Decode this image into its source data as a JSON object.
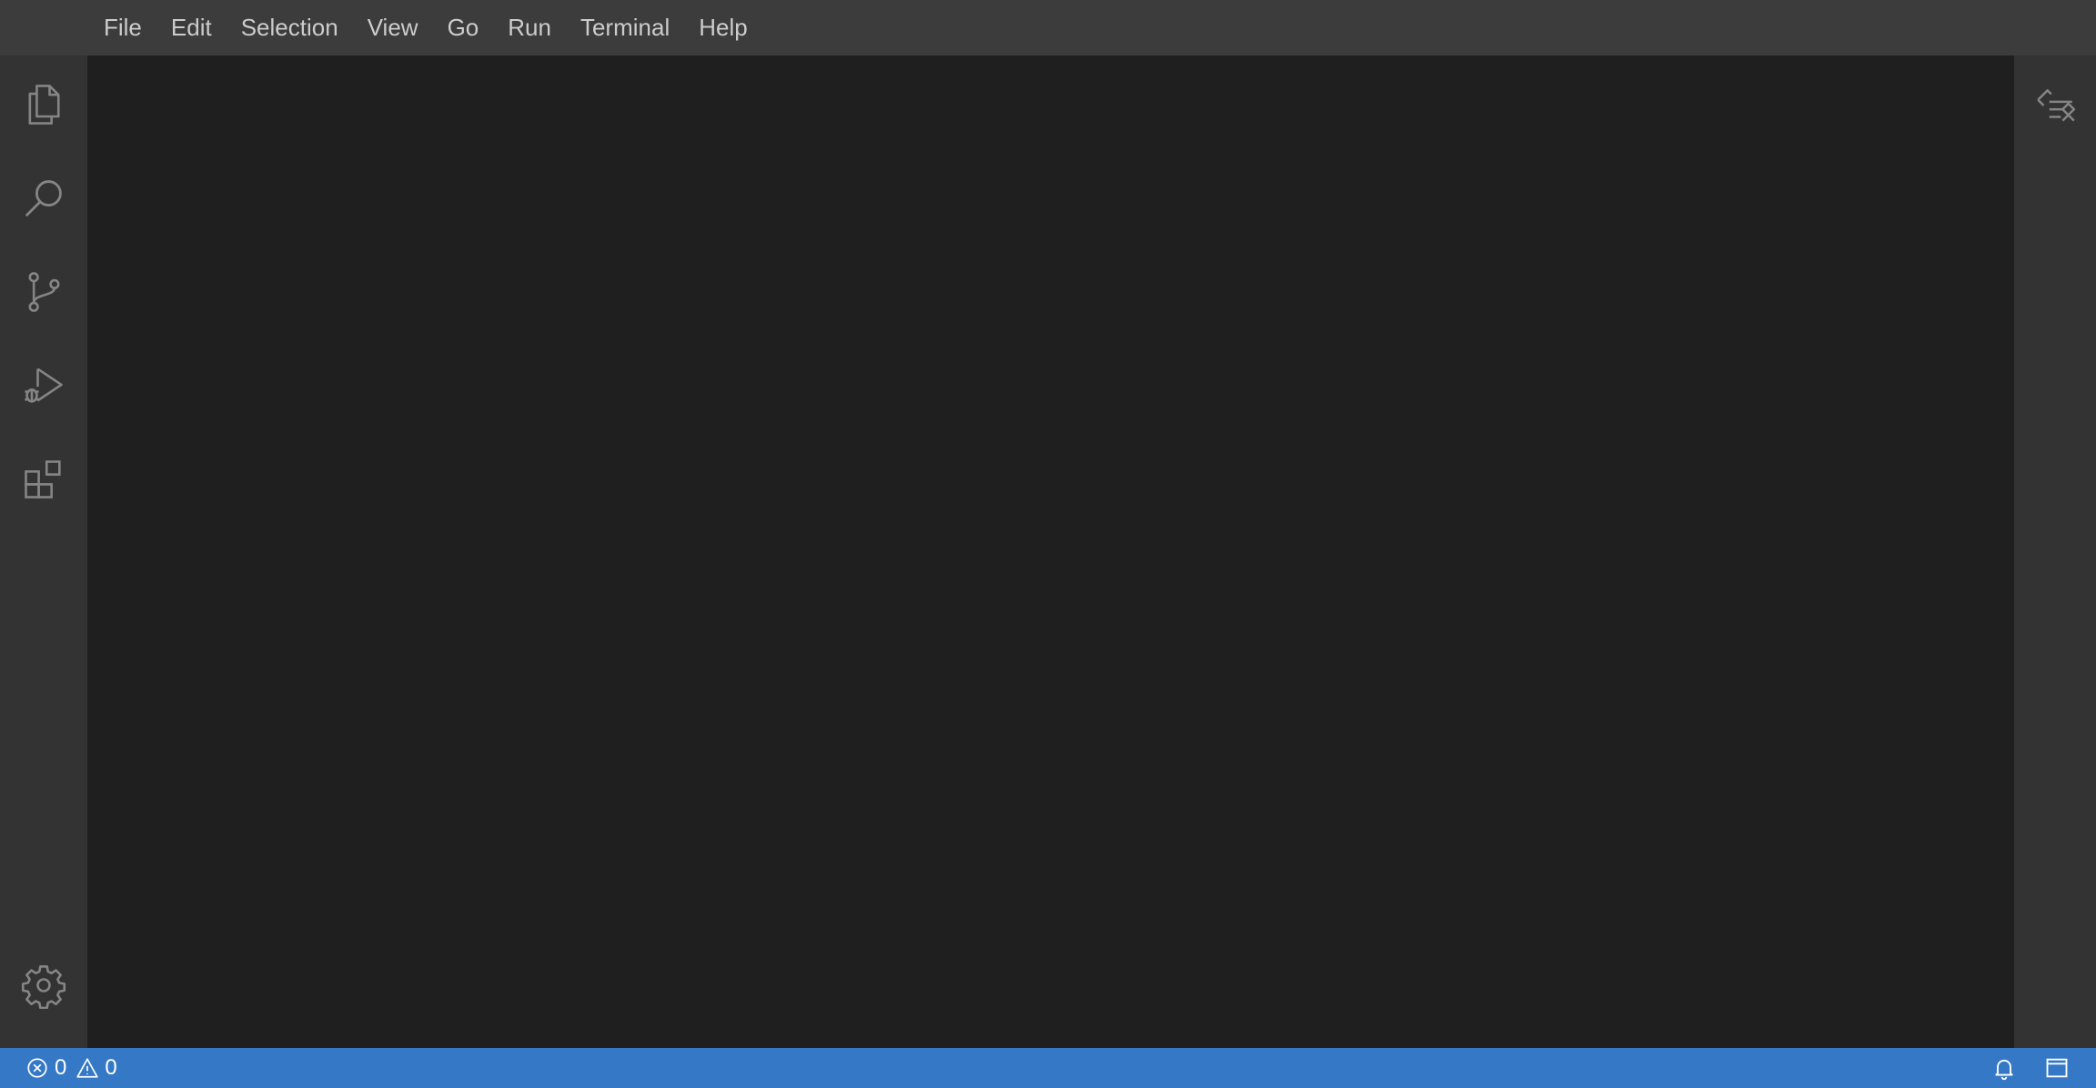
{
  "menu": {
    "items": [
      "File",
      "Edit",
      "Selection",
      "View",
      "Go",
      "Run",
      "Terminal",
      "Help"
    ]
  },
  "activity_bar": {
    "icons": [
      "explorer-icon",
      "search-icon",
      "source-control-icon",
      "run-debug-icon",
      "extensions-icon"
    ],
    "bottom_icon": "gear-icon"
  },
  "secondary_bar": {
    "icon": "timeline-icon"
  },
  "status_bar": {
    "errors": "0",
    "warnings": "0",
    "right_icons": [
      "bell-icon",
      "panel-layout-icon"
    ],
    "background": "#3478c6"
  },
  "colors": {
    "menubar": "#3c3c3c",
    "activitybar": "#333333",
    "editor": "#1f1f1f",
    "icon": "#858585"
  }
}
